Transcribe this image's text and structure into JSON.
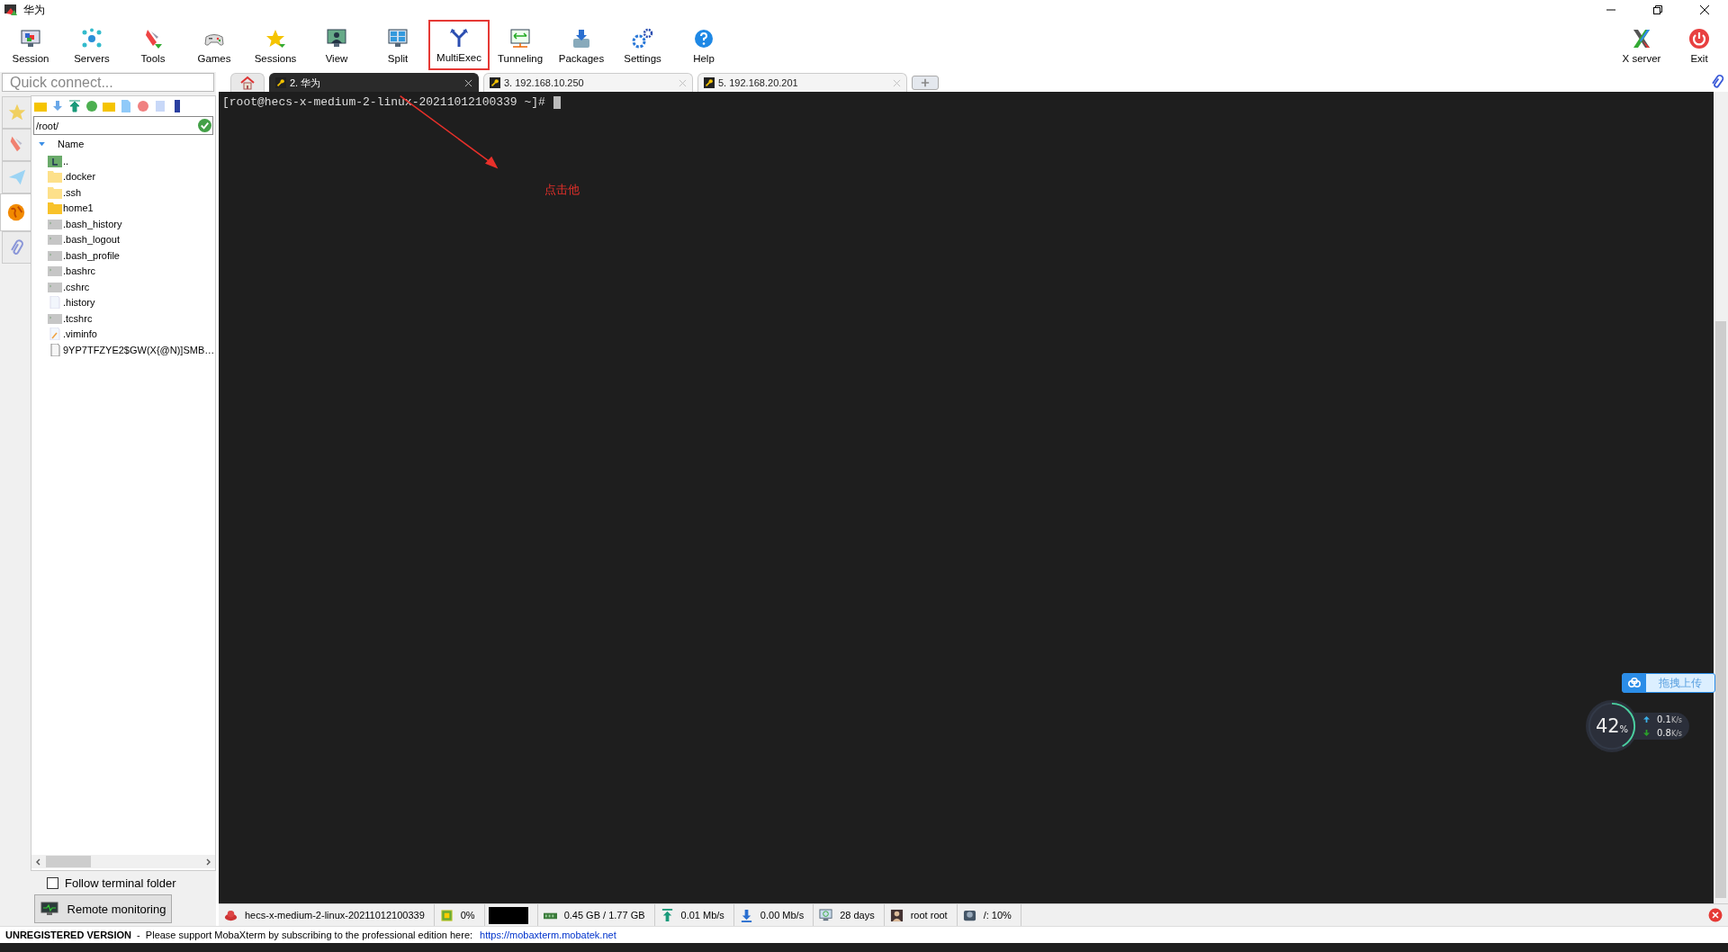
{
  "window": {
    "title": "华为"
  },
  "toolbar": {
    "items": [
      {
        "label": "Session",
        "highlighted": false
      },
      {
        "label": "Servers",
        "highlighted": false
      },
      {
        "label": "Tools",
        "highlighted": false
      },
      {
        "label": "Games",
        "highlighted": false
      },
      {
        "label": "Sessions",
        "highlighted": false
      },
      {
        "label": "View",
        "highlighted": false
      },
      {
        "label": "Split",
        "highlighted": false
      },
      {
        "label": "MultiExec",
        "highlighted": true
      },
      {
        "label": "Tunneling",
        "highlighted": false
      },
      {
        "label": "Packages",
        "highlighted": false
      },
      {
        "label": "Settings",
        "highlighted": false
      },
      {
        "label": "Help",
        "highlighted": false
      }
    ],
    "right_items": [
      {
        "label": "X server"
      },
      {
        "label": "Exit"
      }
    ]
  },
  "quick_connect": {
    "placeholder": "Quick connect..."
  },
  "tabs": [
    {
      "label": "2. 华为",
      "selected": true
    },
    {
      "label": "3. 192.168.10.250",
      "selected": false
    },
    {
      "label": "5. 192.168.20.201",
      "selected": false
    }
  ],
  "side_tabs": [
    {
      "selected": false
    },
    {
      "selected": false
    },
    {
      "selected": false
    },
    {
      "selected": true
    },
    {
      "selected": false
    }
  ],
  "file_panel": {
    "path": "/root/",
    "column": "Name",
    "files": [
      {
        "name": "..",
        "kind": "parent"
      },
      {
        "name": ".docker",
        "kind": "hidden-folder"
      },
      {
        "name": ".ssh",
        "kind": "hidden-folder"
      },
      {
        "name": "home1",
        "kind": "folder"
      },
      {
        "name": ".bash_history",
        "kind": "shell"
      },
      {
        "name": ".bash_logout",
        "kind": "shell"
      },
      {
        "name": ".bash_profile",
        "kind": "shell"
      },
      {
        "name": ".bashrc",
        "kind": "shell"
      },
      {
        "name": ".cshrc",
        "kind": "shell"
      },
      {
        "name": ".history",
        "kind": "blank"
      },
      {
        "name": ".tcshrc",
        "kind": "shell"
      },
      {
        "name": ".viminfo",
        "kind": "note"
      },
      {
        "name": "9YP7TFZYE2$GW(X{@N)]SMB…",
        "kind": "file"
      }
    ]
  },
  "follow_terminal_folder": {
    "label": "Follow terminal folder",
    "checked": false
  },
  "remote_monitoring": {
    "label": "Remote monitoring"
  },
  "terminal": {
    "prompt": "[root@hecs-x-medium-2-linux-20211012100339 ~]#"
  },
  "annotation": {
    "text": "点击他"
  },
  "status_bar": [
    {
      "kind": "host",
      "text": "hecs-x-medium-2-linux-20211012100339"
    },
    {
      "kind": "cpu",
      "text": "0%"
    },
    {
      "kind": "graph"
    },
    {
      "kind": "memory",
      "text": "0.45 GB / 1.77 GB"
    },
    {
      "kind": "upload",
      "text": "0.01 Mb/s"
    },
    {
      "kind": "download",
      "text": "0.00 Mb/s"
    },
    {
      "kind": "uptime",
      "text": "28 days"
    },
    {
      "kind": "user",
      "text": "root  root"
    },
    {
      "kind": "disk",
      "text": "/: 10%"
    }
  ],
  "footer": {
    "notice": "**UNREGISTERED VERSION**  -  Please support MobaXterm by subscribing to the professional edition here:",
    "link": "https://mobaxterm.mobatek.net"
  },
  "net_widget": {
    "button": "拖拽上传",
    "percent": "42",
    "percent_unit": "%",
    "level": 0.42,
    "up": "0.1",
    "up_unit": "K/s",
    "down": "0.8",
    "down_unit": "K/s"
  }
}
